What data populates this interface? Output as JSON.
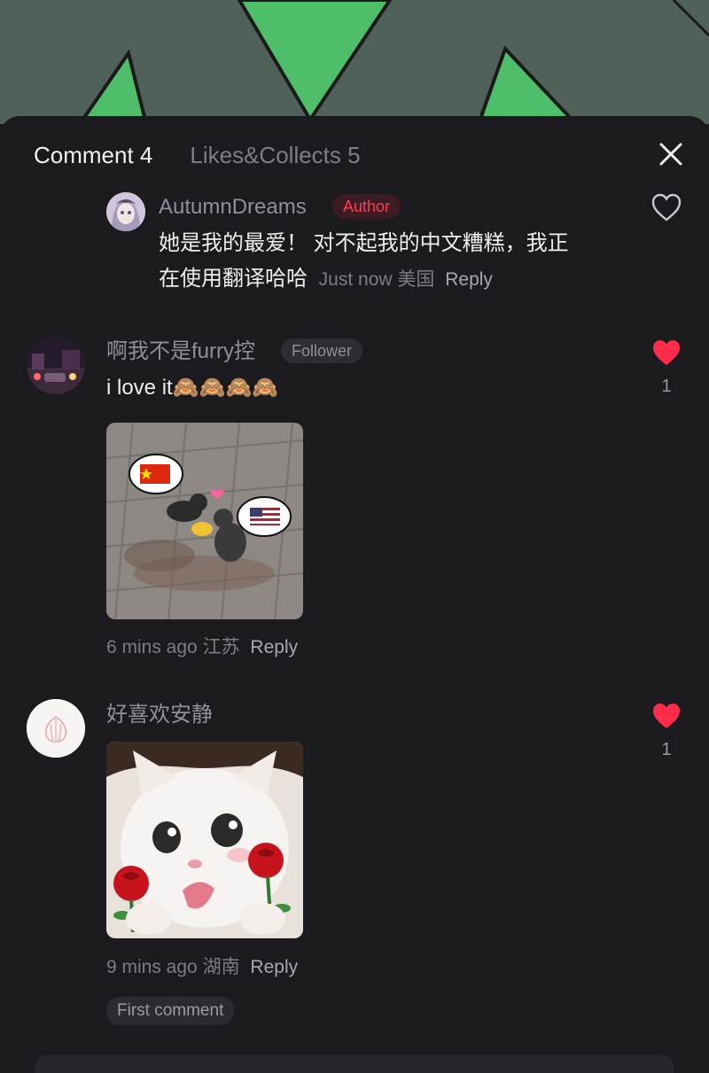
{
  "tabs": [
    {
      "label": "Comment 4"
    },
    {
      "label": "Likes&Collects 5"
    }
  ],
  "icons": {
    "close": "close-icon",
    "heart_outline": "heart-outline-icon",
    "heart_filled": "heart-filled-icon"
  },
  "colors": {
    "like_red": "#ff2d4a",
    "author_badge": "#ff3d53",
    "background": "#1b1b1f"
  },
  "comments": [
    {
      "username": "AutumnDreams",
      "badge": "Author",
      "text_line1": "她是我的最爱！ 对不起我的中文糟糕，我正",
      "text_line2": "在使用翻译哈哈",
      "time": "Just now",
      "location": "美国",
      "reply": "Reply",
      "liked": false
    },
    {
      "username": "啊我不是furry控",
      "badge": "Follower",
      "text": "i love it🙈🙈🙈🙈",
      "image": "cats-handshake-flags-image",
      "time": "6 mins ago",
      "location": "江苏",
      "reply": "Reply",
      "liked": true,
      "like_count": "1"
    },
    {
      "username": "好喜欢安静",
      "image": "kitten-roses-image",
      "time": "9 mins ago",
      "location": "湖南",
      "reply": "Reply",
      "liked": true,
      "like_count": "1",
      "tag": "First comment"
    }
  ]
}
